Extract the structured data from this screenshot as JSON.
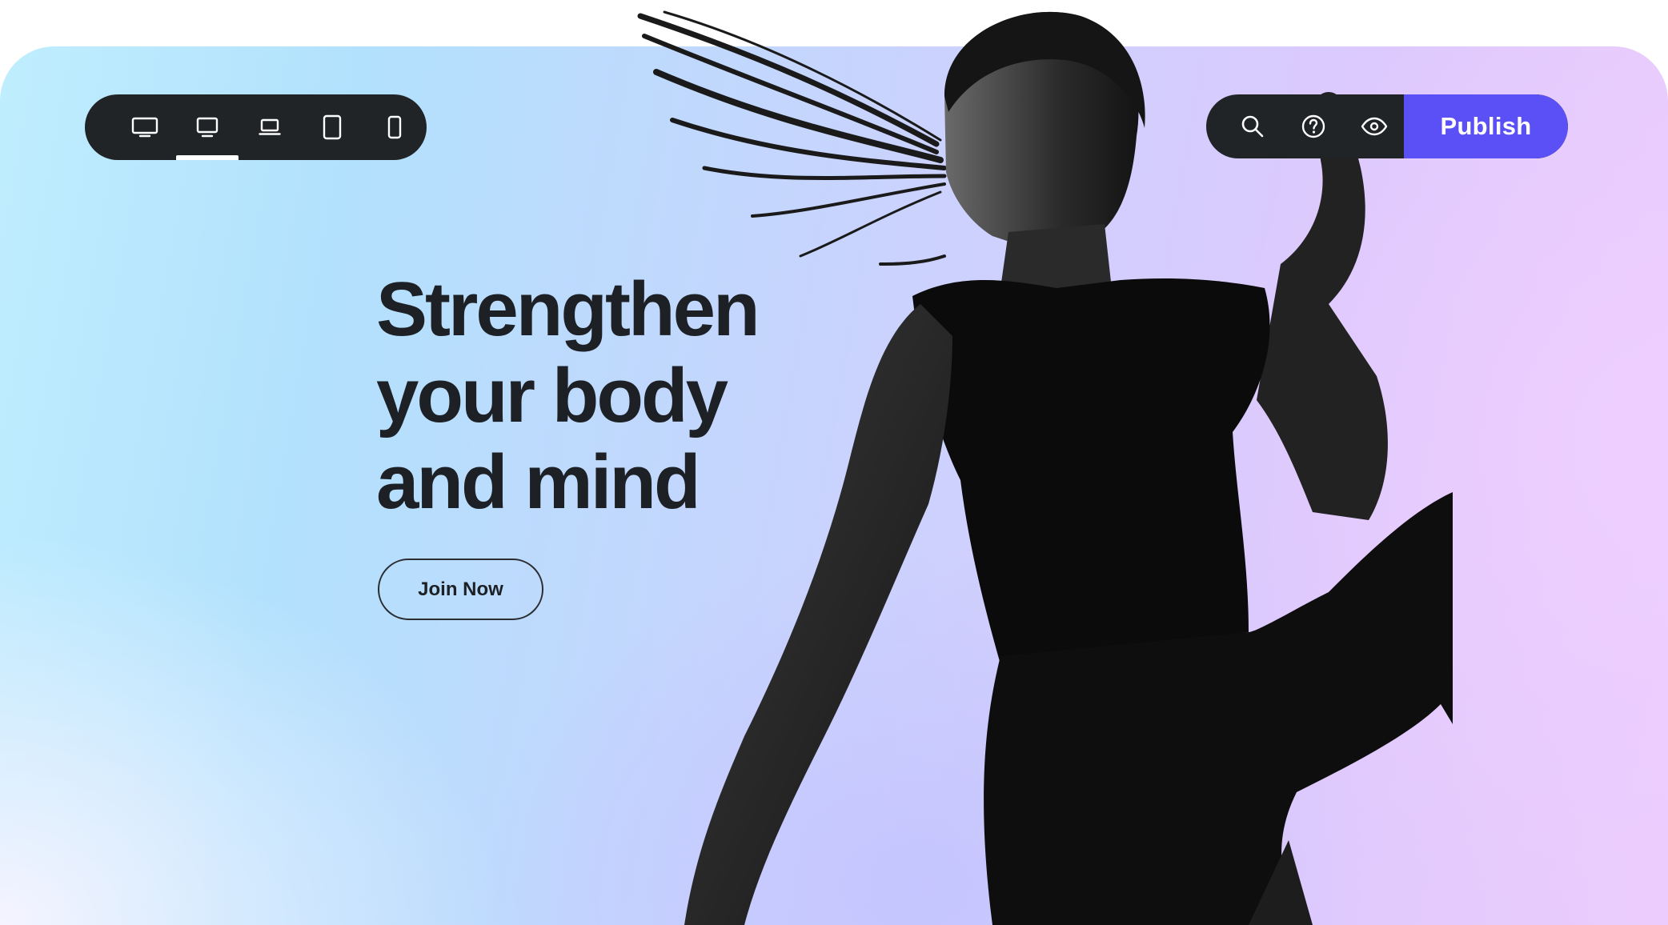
{
  "toolbar": {
    "devices": [
      {
        "name": "desktop-large-icon",
        "active": false
      },
      {
        "name": "desktop-icon",
        "active": true
      },
      {
        "name": "laptop-icon",
        "active": false
      },
      {
        "name": "tablet-icon",
        "active": false
      },
      {
        "name": "mobile-icon",
        "active": false
      }
    ],
    "actions": [
      {
        "name": "search-icon"
      },
      {
        "name": "help-icon"
      },
      {
        "name": "preview-eye-icon"
      }
    ],
    "publish_label": "Publish"
  },
  "hero": {
    "headline_lines": [
      "Strengthen",
      "your body",
      "and mind"
    ],
    "cta_label": "Join Now",
    "image_subject": "athlete-photo"
  },
  "colors": {
    "toolbar_bg": "#212427",
    "publish_bg": "#5b50f5",
    "headline": "#1d2024",
    "gradient_left": "#bfeefe",
    "gradient_right": "#ecccfd"
  }
}
